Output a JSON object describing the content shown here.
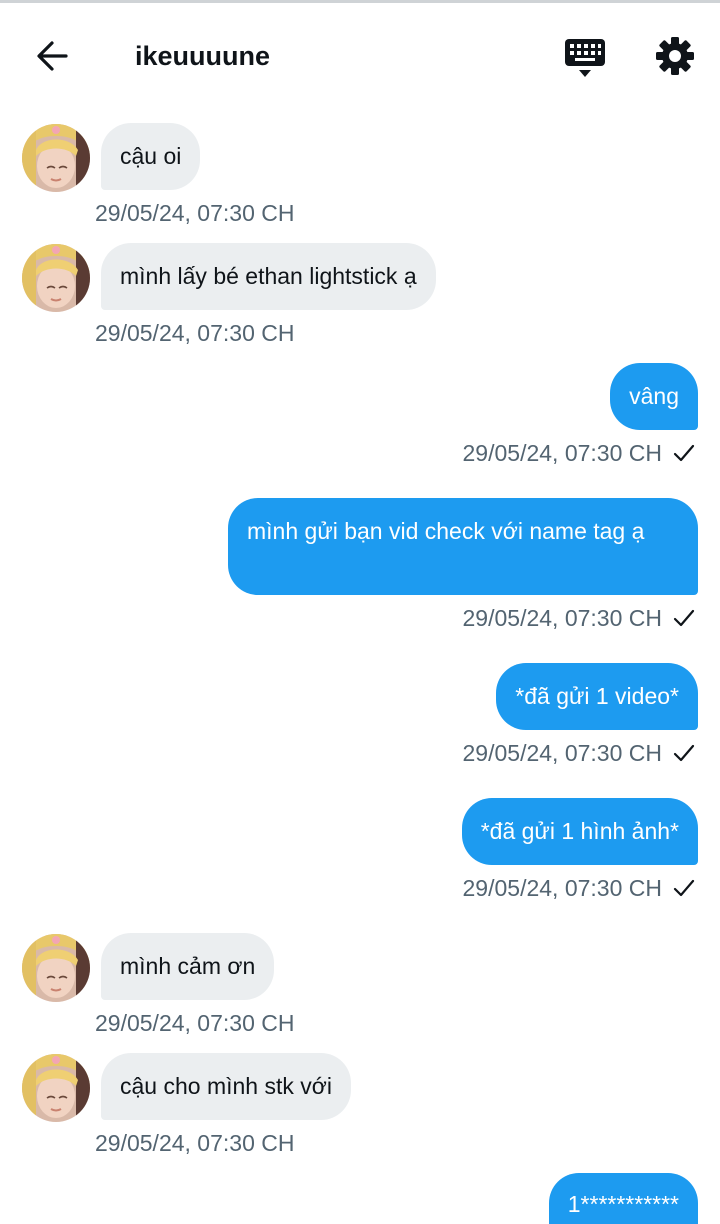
{
  "header": {
    "title": "ikeuuuune"
  },
  "icons": {
    "back": "arrow-left-icon",
    "keyboard": "keyboard-icon",
    "settings": "gear-icon",
    "read": "check-icon"
  },
  "colors": {
    "outgoing_bubble": "#1d9bf0",
    "incoming_bubble": "#ebeef0",
    "timestamp": "#536471"
  },
  "messages": [
    {
      "direction": "in",
      "text": "cậu oi",
      "time": "29/05/24, 07:30 CH"
    },
    {
      "direction": "in",
      "text": "mình lấy bé ethan lightstick ạ",
      "time": "29/05/24, 07:30 CH"
    },
    {
      "direction": "out",
      "text": "vâng",
      "time": "29/05/24, 07:30 CH"
    },
    {
      "direction": "out",
      "text": "mình gửi bạn vid check với name tag ạ",
      "time": "29/05/24, 07:30 CH"
    },
    {
      "direction": "out",
      "text": "*đã gửi 1 video*",
      "time": "29/05/24, 07:30 CH"
    },
    {
      "direction": "out",
      "text": "*đã gửi 1 hình ảnh*",
      "time": "29/05/24, 07:30 CH"
    },
    {
      "direction": "in",
      "text": "mình cảm ơn",
      "time": "29/05/24, 07:30 CH"
    },
    {
      "direction": "in",
      "text": "cậu cho mình stk với",
      "time": "29/05/24, 07:30 CH"
    },
    {
      "direction": "out",
      "text": "1***********",
      "time": ""
    }
  ]
}
